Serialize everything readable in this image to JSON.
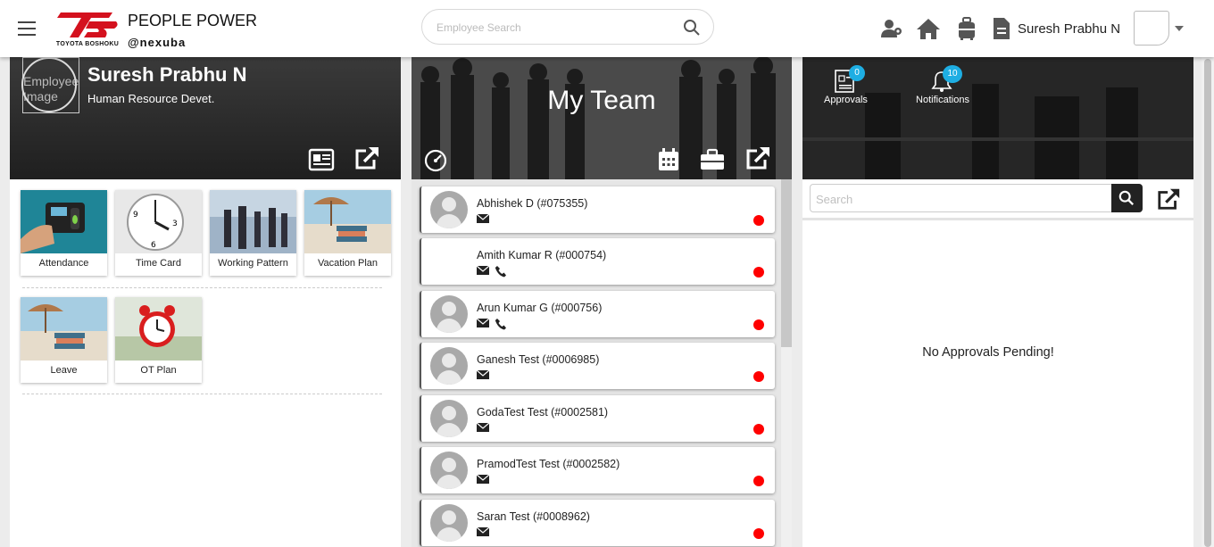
{
  "header": {
    "brand_title": "PEOPLE POWER",
    "brand_sub": "@nexuba",
    "logo_text": "TOYOTA BOSHOKU",
    "search_placeholder": "Employee Search",
    "user_name": "Suresh Prabhu N",
    "icons": [
      "menu-icon",
      "team-icon",
      "home-icon",
      "luggage-icon",
      "document-icon",
      "search-icon"
    ]
  },
  "profile": {
    "image_alt": "Employee Image",
    "name": "Suresh Prabhu N",
    "department": "Human Resource Devet.",
    "tiles": [
      {
        "label": "Attendance"
      },
      {
        "label": "Time Card"
      },
      {
        "label": "Working Pattern"
      },
      {
        "label": "Vacation Plan"
      },
      {
        "label": "Leave"
      },
      {
        "label": "OT Plan"
      }
    ]
  },
  "team": {
    "title": "My Team",
    "members": [
      {
        "name": "Abhishek D (#075355)",
        "phone": false,
        "avatar": true,
        "status": "offline"
      },
      {
        "name": "Amith Kumar R (#000754)",
        "phone": true,
        "avatar": false,
        "status": "offline"
      },
      {
        "name": "Arun Kumar G (#000756)",
        "phone": true,
        "avatar": true,
        "status": "offline"
      },
      {
        "name": "Ganesh Test (#0006985)",
        "phone": false,
        "avatar": true,
        "status": "offline"
      },
      {
        "name": "GodaTest Test (#0002581)",
        "phone": false,
        "avatar": true,
        "status": "offline"
      },
      {
        "name": "PramodTest Test (#0002582)",
        "phone": false,
        "avatar": true,
        "status": "offline"
      },
      {
        "name": "Saran Test (#0008962)",
        "phone": false,
        "avatar": true,
        "status": "offline"
      }
    ],
    "status_color": "#ff0000"
  },
  "approvals": {
    "approvals_label": "Approvals",
    "approvals_count": "0",
    "notifications_label": "Notifications",
    "notifications_count": "10",
    "search_placeholder": "Search",
    "empty_message": "No Approvals Pending!",
    "badge_color": "#1eaee3"
  }
}
